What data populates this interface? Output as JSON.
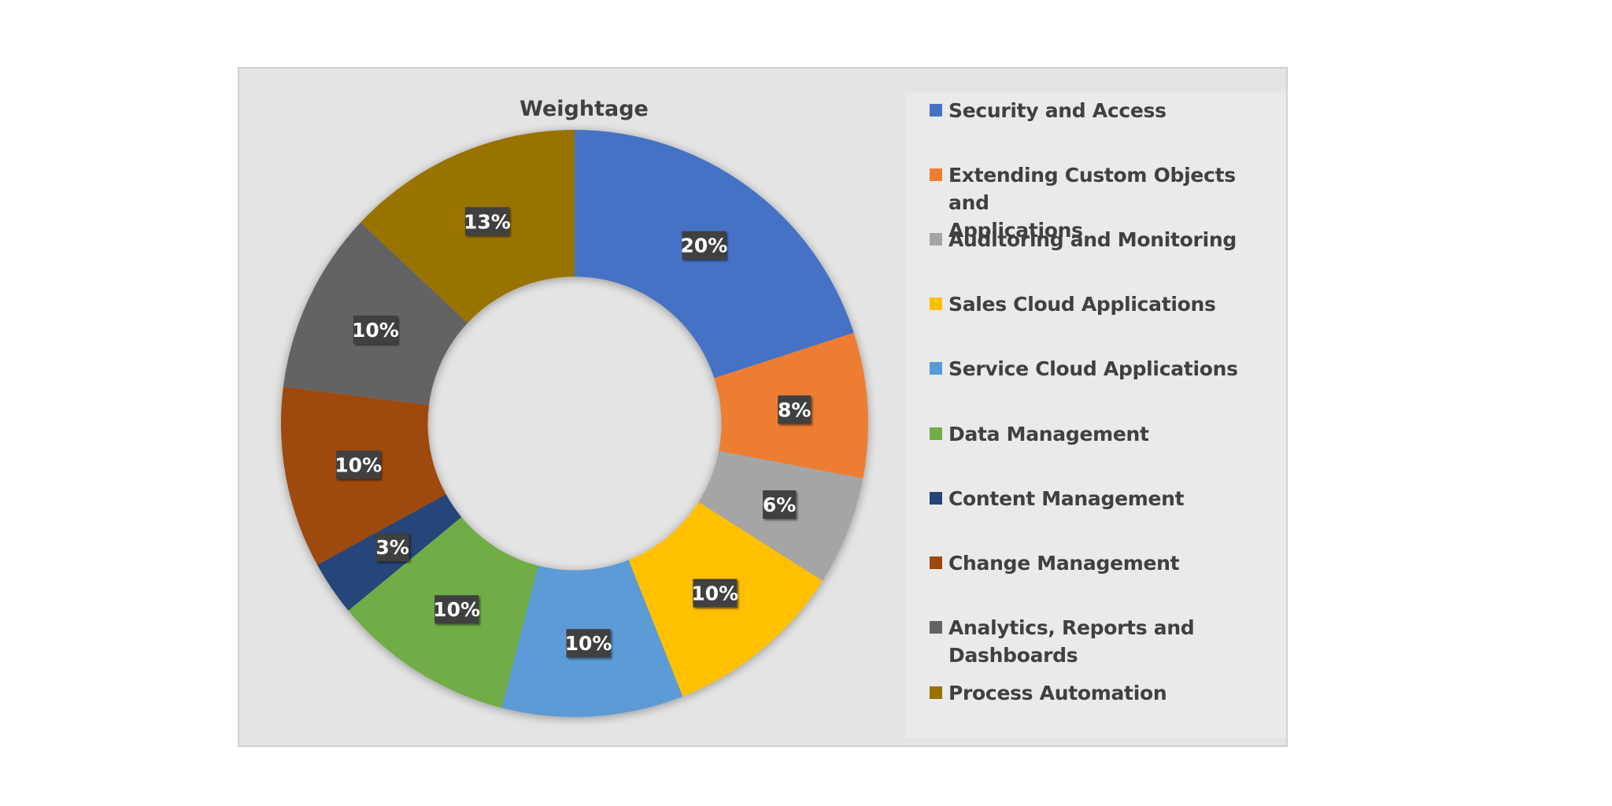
{
  "chart_data": {
    "type": "pie",
    "variant": "donut",
    "title": "Weightage",
    "start_angle_deg": 0,
    "direction": "clockwise",
    "hole_fraction": 0.5,
    "legend_position": "right",
    "slices": [
      {
        "label": "Security and Access",
        "value": 20,
        "display": "20%",
        "color": "#4472c4"
      },
      {
        "label": "Extending Custom Objects and Applications",
        "value": 8,
        "display": "8%",
        "color": "#ed7d31"
      },
      {
        "label": "Auditoring and Monitoring",
        "value": 6,
        "display": "6%",
        "color": "#a5a5a5"
      },
      {
        "label": "Sales Cloud Applications",
        "value": 10,
        "display": "10%",
        "color": "#ffc000"
      },
      {
        "label": "Service Cloud Applications",
        "value": 10,
        "display": "10%",
        "color": "#5b9bd5"
      },
      {
        "label": "Data Management",
        "value": 10,
        "display": "10%",
        "color": "#70ad47"
      },
      {
        "label": "Content Management",
        "value": 3,
        "display": "3%",
        "color": "#264478"
      },
      {
        "label": "Change Management",
        "value": 10,
        "display": "10%",
        "color": "#9e480e"
      },
      {
        "label": "Analytics, Reports and Dashboards",
        "value": 10,
        "display": "10%",
        "color": "#636363"
      },
      {
        "label": "Process Automation",
        "value": 13,
        "display": "13%",
        "color": "#997300"
      }
    ],
    "legend": [
      {
        "label": "Security and Access",
        "lines": [
          "Security and Access"
        ],
        "color": "#4472c4"
      },
      {
        "label": "Extending Custom Objects and Applications",
        "lines": [
          "Extending Custom Objects and",
          "Applications"
        ],
        "color": "#ed7d31"
      },
      {
        "label": "Auditoring and Monitoring",
        "lines": [
          "Auditoring and Monitoring"
        ],
        "color": "#a5a5a5"
      },
      {
        "label": "Sales Cloud Applications",
        "lines": [
          "Sales Cloud Applications"
        ],
        "color": "#ffc000"
      },
      {
        "label": "Service Cloud Applications",
        "lines": [
          "Service Cloud Applications"
        ],
        "color": "#5b9bd5"
      },
      {
        "label": "Data Management",
        "lines": [
          "Data Management"
        ],
        "color": "#70ad47"
      },
      {
        "label": "Content Management",
        "lines": [
          "Content Management"
        ],
        "color": "#264478"
      },
      {
        "label": "Change Management",
        "lines": [
          "Change Management"
        ],
        "color": "#9e480e"
      },
      {
        "label": "Analytics, Reports and Dashboards",
        "lines": [
          "Analytics, Reports and",
          "Dashboards"
        ],
        "color": "#636363"
      },
      {
        "label": "Process Automation",
        "lines": [
          "Process Automation"
        ],
        "color": "#997300"
      }
    ]
  }
}
